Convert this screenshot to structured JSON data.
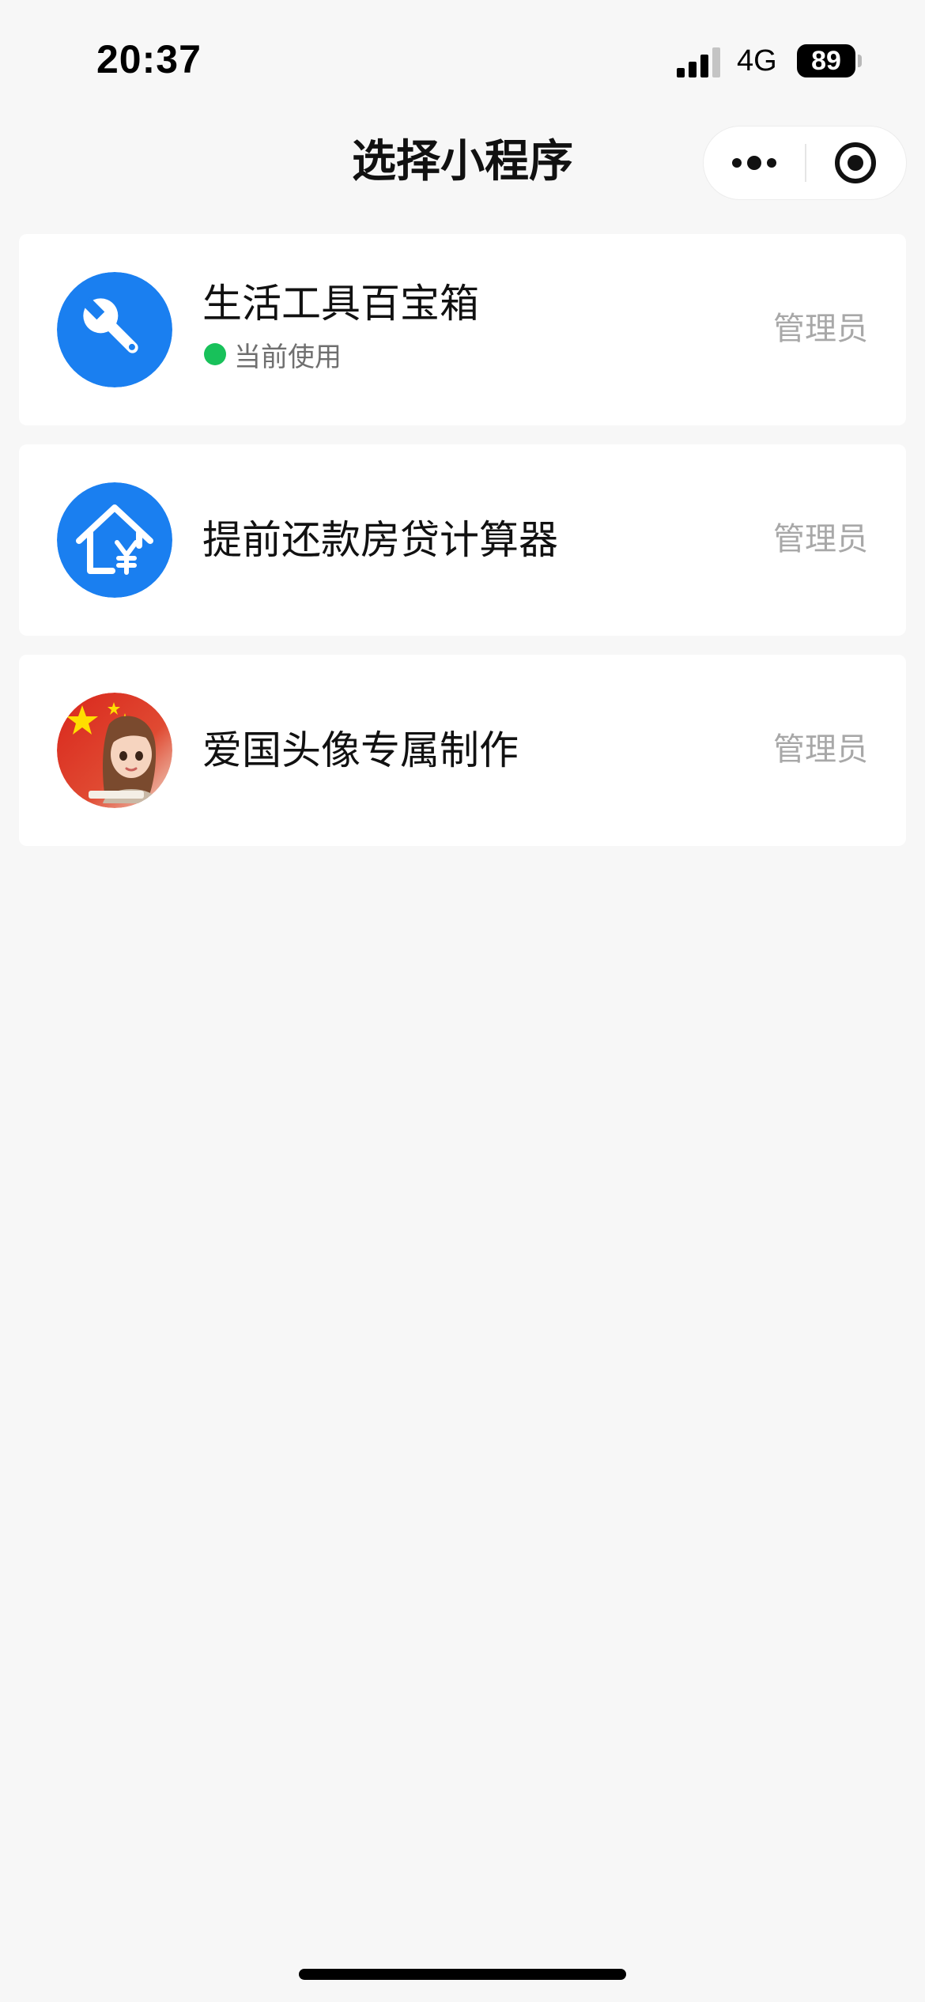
{
  "status_bar": {
    "time": "20:37",
    "network": "4G",
    "battery": "89"
  },
  "nav": {
    "title": "选择小程序",
    "more_icon": "more-dots-icon",
    "close_icon": "target-close-icon"
  },
  "colors": {
    "icon_blue": "#1a7ff0",
    "status_green": "#18c15a",
    "role_gray": "#a8a8a8"
  },
  "mini_programs": [
    {
      "name": "生活工具百宝箱",
      "status": "当前使用",
      "role": "管理员",
      "icon": "wrench-icon"
    },
    {
      "name": "提前还款房贷计算器",
      "role": "管理员",
      "icon": "house-yen-icon"
    },
    {
      "name": "爱国头像专属制作",
      "role": "管理员",
      "icon": "flag-avatar-icon"
    }
  ]
}
